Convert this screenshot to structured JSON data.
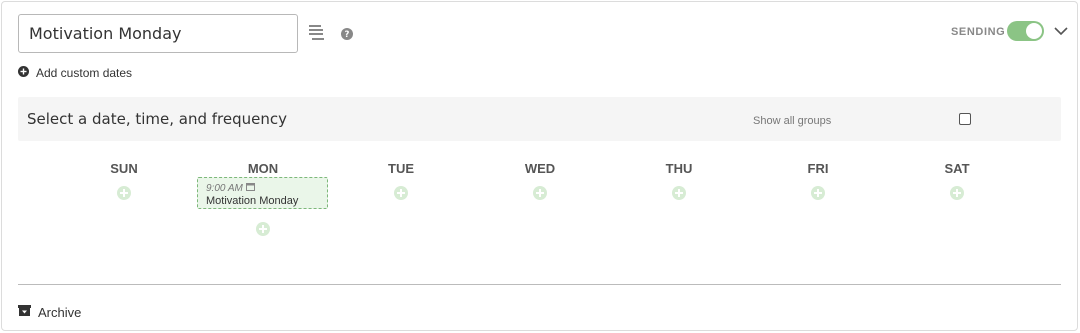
{
  "message": {
    "title_value": "Motivation Monday",
    "placeholder": ""
  },
  "toolbar": {
    "add_custom_dates_label": "Add custom dates"
  },
  "status": {
    "sending_label": "SENDING",
    "sending_on": true,
    "toggle_color": "#8bc485"
  },
  "frequency": {
    "title": "Select a date, time, and frequency",
    "show_all_groups_label": "Show all groups",
    "show_all_groups_checked": false
  },
  "days": [
    "SUN",
    "MON",
    "TUE",
    "WED",
    "THU",
    "FRI",
    "SAT"
  ],
  "event": {
    "day": "MON",
    "time": "9:00 AM",
    "name": "Motivation Monday",
    "color": "#eaf6e9",
    "border": "#7db87a"
  },
  "footer": {
    "archive_label": "Archive"
  },
  "icons": [
    "stack-icon",
    "help-icon",
    "chevron-down-icon",
    "plus-circle-icon",
    "add-icon",
    "calendar-icon",
    "archive-icon"
  ]
}
